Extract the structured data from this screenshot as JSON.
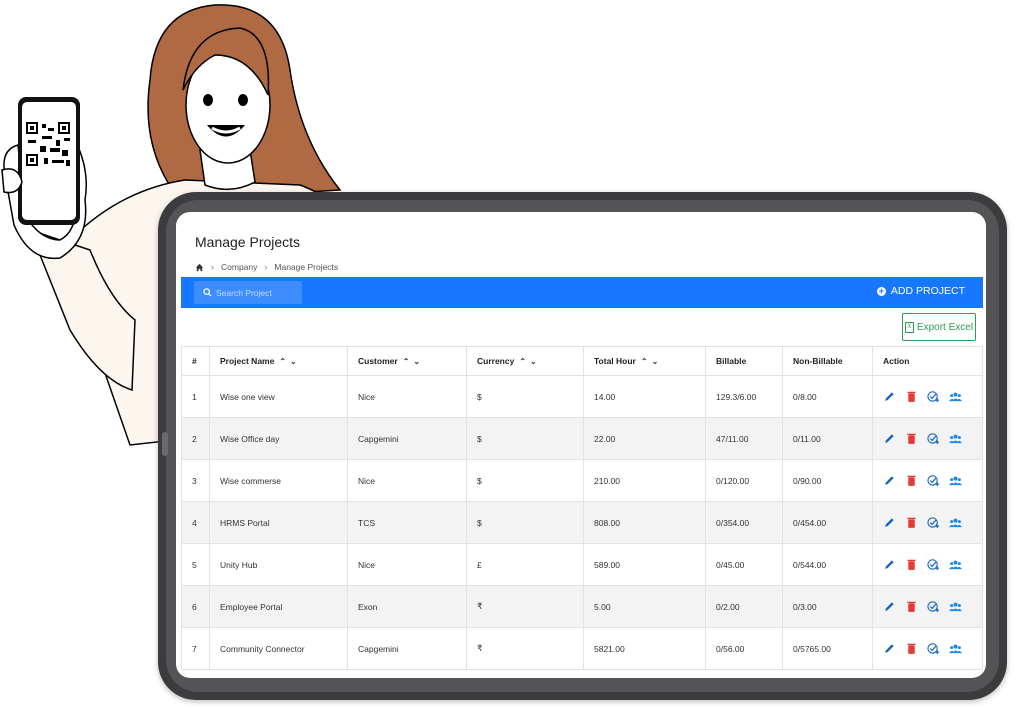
{
  "page": {
    "title": "Manage Projects",
    "breadcrumb": [
      "Company",
      "Manage Projects"
    ]
  },
  "toolbar": {
    "search_placeholder": "Search Project",
    "add_label": "ADD PROJECT"
  },
  "export_label": "Export Excel",
  "table": {
    "headers": [
      "#",
      "Project Name",
      "Customer",
      "Currency",
      "Total Hour",
      "Billable",
      "Non-Billable",
      "Action"
    ],
    "rows": [
      [
        "1",
        "Wise one view",
        "Nice",
        "$",
        "14.00",
        "129.3/6.00",
        "0/8.00"
      ],
      [
        "2",
        "Wise Office day",
        "Capgemini",
        "$",
        "22.00",
        "47/11.00",
        "0/11.00"
      ],
      [
        "3",
        "Wise commerse",
        "Nice",
        "$",
        "210.00",
        "0/120.00",
        "0/90.00"
      ],
      [
        "4",
        "HRMS Portal",
        "TCS",
        "$",
        "808.00",
        "0/354.00",
        "0/454.00"
      ],
      [
        "5",
        "Unity Hub",
        "Nice",
        "£",
        "589.00",
        "0/45.00",
        "0/544.00"
      ],
      [
        "6",
        "Employee Portal",
        "Exon",
        "₹",
        "5.00",
        "0/2.00",
        "0/3.00"
      ],
      [
        "7",
        "Community Connector",
        "Capgemini",
        "₹",
        "5821.00",
        "0/56.00",
        "0/5765.00"
      ]
    ]
  },
  "icons": {
    "row_actions": [
      "edit-icon",
      "delete-icon",
      "approve-icon",
      "team-icon"
    ]
  },
  "colors": {
    "toolbar": "#1778ff",
    "export": "#2e9e55",
    "edit": "#1565c0",
    "delete": "#e53935",
    "team": "#1e88e5"
  }
}
